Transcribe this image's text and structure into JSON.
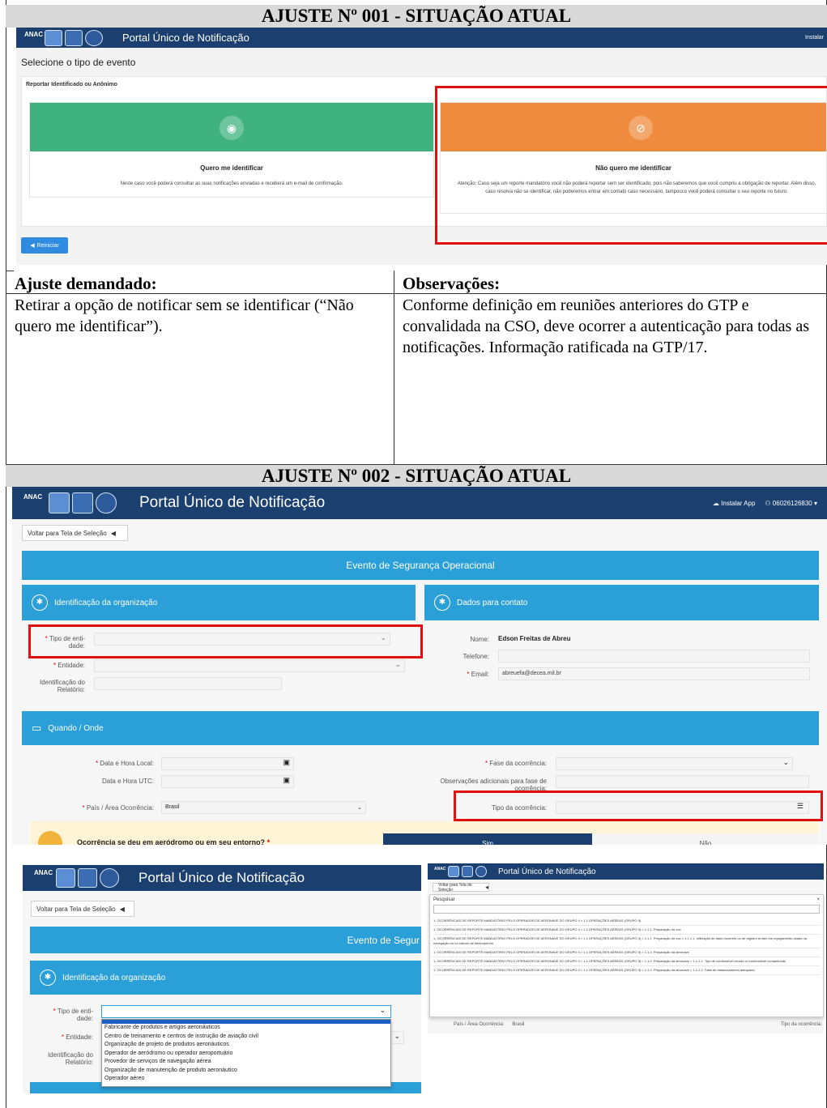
{
  "section1": {
    "title": "AJUSTE Nº 001 - SITUAÇÃO ATUAL",
    "screen": {
      "portal_title": "Portal Único de Notificação",
      "install_label": "Instalar",
      "heading": "Selecione o tipo de evento",
      "subheading": "Reportar Identificado ou Anônimo",
      "option_identify": {
        "title": "Quero me identificar",
        "text": "Neste caso você poderá consultar as suas notificações enviadas e receberá um e-mail de confirmação."
      },
      "option_anonymous": {
        "title": "Não quero me identificar",
        "text": "Atenção: Caso seja um reporte mandatório você não poderá reportar sem ser identificado, pois não saberemos que você cumpriu a obrigação de reportar. Além disso, caso resolva não se identificar, não poderemos entrar em contato caso necessário, tampouco você poderá consultar o seu reporte no futuro."
      },
      "restart_label": "Reiniciar"
    },
    "ajuste_header": "Ajuste demandado:",
    "ajuste_text": "Retirar a opção de notificar sem se identificar (“Não quero me identificar”).",
    "obs_header": "Observações:",
    "obs_text": "Conforme definição em reuniões anteriores do GTP e convalidada na CSO, deve ocorrer a autenticação para todas as notificações. Informação ratificada na GTP/17."
  },
  "section2": {
    "title": "AJUSTE Nº 002 - SITUAÇÃO ATUAL",
    "screen": {
      "portal_title": "Portal Único de Notificação",
      "install_label": "Instalar App",
      "user_label": "06026126830",
      "back_label": "Voltar para Tela de Seleção",
      "event_title": "Evento de Segurança Operacional",
      "org_panel_title": "Identificação da organização",
      "contact_panel_title": "Dados para contato",
      "fields": {
        "tipo_entidade": "Tipo de enti-dade:",
        "entidade": "Entidade:",
        "identificacao": "Identificação do Relatório:",
        "nome_label": "Nome:",
        "nome_value": "Edson Freitas de Abreu",
        "telefone_label": "Telefone:",
        "email_label": "Email:",
        "email_value": "abreuefa@decea.mil.br"
      },
      "when_panel_title": "Quando / Onde",
      "when_fields": {
        "data_local": "Data e Hora Local:",
        "data_utc": "Data e Hora UTC:",
        "pais": "País / Área Ocorrência:",
        "pais_value": "Brasil",
        "fase": "Fase da ocorrência:",
        "obs_fase": "Observações adicionais para fase de ocorrência:",
        "tipo_ocorrencia": "Tipo da ocorrência:"
      },
      "question": "Ocorrência se deu em aeródromo ou em seu entorno?",
      "yes": "Sim",
      "no": "Não"
    },
    "screen_dropdown": {
      "portal_title": "Portal Único de Notificação",
      "back_label": "Voltar para Tela de Seleção",
      "event_title": "Evento de Segur",
      "org_panel_title": "Identificação da organização",
      "tipo_entidade": "Tipo de enti-dade:",
      "entidade": "Entidade:",
      "identificacao": "Identificação do Relatório:",
      "options": [
        "Fabricante de produtos e artigos aeronáuticos",
        "Centro de treinamento e centros de instrução de aviação civil",
        "Organização de projeto de produtos aeronáuticos",
        "Operador de aeródromo ou operador aeroportuário",
        "Provedor de serviços de navegação aérea",
        "Organização de manutenção de produto aeronáutico",
        "Operador aéreo"
      ]
    },
    "screen_search": {
      "portal_title": "Portal Único de Notificação",
      "back_label": "Voltar para Tela de Seleção",
      "search_label": "Pesquisar",
      "results": [
        "1. OCORRÊNCIAS DE REPORTE MANDATÓRIO PELO OPERADOR DE AERONAVE DO GRUPO II > 1.1 OPERAÇÕES AÉREAS (GRUPO II)",
        "1. OCORRÊNCIAS DE REPORTE MANDATÓRIO PELO OPERADOR DE AERONAVE DO GRUPO II > 1.1 OPERAÇÕES AÉREAS (GRUPO II) > 1.1.1. Preparação do voo",
        "1. OCORRÊNCIAS DE REPORTE MANDATÓRIO PELO OPERADOR DE AERONAVE DO GRUPO II > 1.1 OPERAÇÕES AÉREAS (GRUPO II) > 1.1.1. Preparação do voo > 1.1.1.1. Utilização de dado incorreto ou de registro errado em equipamento usado na navegação ou no cálculo de desempenho",
        "1. OCORRÊNCIAS DE REPORTE MANDATÓRIO PELO OPERADOR DE AERONAVE DO GRUPO II > 1.1 OPERAÇÕES AÉREAS (GRUPO II) > 1.1.2. Preparação da aeronave",
        "1. OCORRÊNCIAS DE REPORTE MANDATÓRIO PELO OPERADOR DE AERONAVE DO GRUPO II > 1.1 OPERAÇÕES AÉREAS (GRUPO II) > 1.1.2. Preparação da aeronave > 1.1.2.1. Tipo de combustível errado ou combustível contaminado",
        "1. OCORRÊNCIAS DE REPORTE MANDATÓRIO PELO OPERADOR DE AERONAVE DO GRUPO II > 1.1 OPERAÇÕES AÉREAS (GRUPO II) > 1.1.2. Preparação da aeronave > 1.1.2.2. Falta de balanceamento adequado"
      ]
    }
  }
}
